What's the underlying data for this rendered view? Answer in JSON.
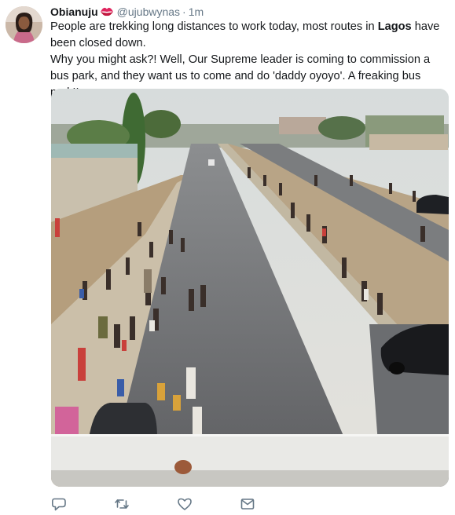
{
  "tweet": {
    "display_name": "Obianuju",
    "handle": "@ujubwynas",
    "separator": "·",
    "time": "1m",
    "line1_pre": "People are trekking long distances to work today, most routes in ",
    "line1_bold": "Lagos",
    "line1_post": " have been closed down.",
    "line2": "Why you might ask?! Well, Our Supreme leader is coming to commission a bus park, and they want us to come and do 'daddy oyoyo'. A freaking bus park!!"
  },
  "icons": {
    "emoji": "kiss-lips-icon",
    "reply": "reply-icon",
    "retweet": "retweet-icon",
    "like": "like-icon",
    "dm": "direct-message-icon"
  },
  "colors": {
    "text": "#14171a",
    "muted": "#657786",
    "icon": "#657786",
    "lips": "#e0245e"
  }
}
